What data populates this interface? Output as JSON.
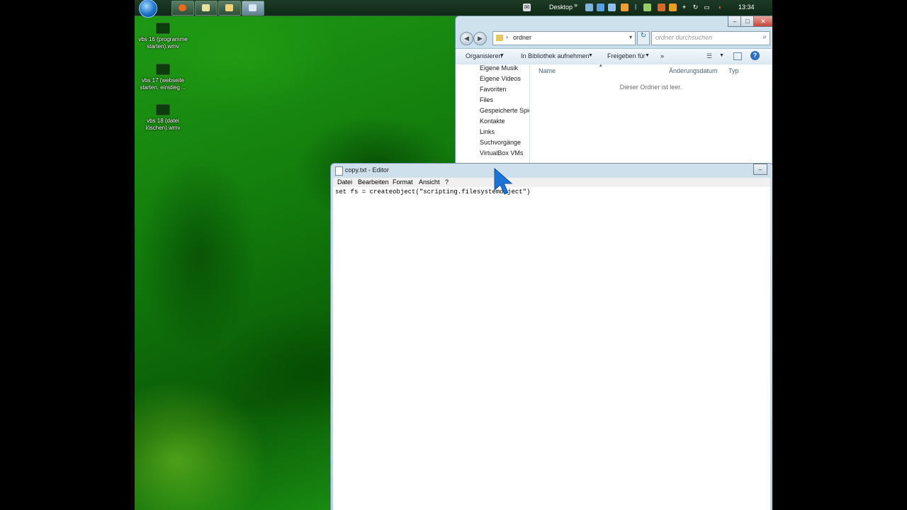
{
  "taskbar": {
    "desktop_label": "Desktop",
    "clock": "13:34",
    "tray_icons": [
      "network-icon",
      "chrome-icon",
      "network-icon",
      "folder-icon",
      "bluetooth-icon",
      "usb-icon",
      "arrow-icon",
      "flag-icon",
      "display-icon",
      "volume-muted-icon"
    ]
  },
  "desktop_icons": [
    {
      "label": "vbs 16 (programme starten).wmv"
    },
    {
      "label": "vbs 17 (webseite starten, einstieg ..."
    },
    {
      "label": "vbs 18 (datei löschen).wmv"
    }
  ],
  "explorer": {
    "address": "ordner",
    "search_placeholder": "ordner durchsuchen",
    "commands": {
      "organize": "Organisieren",
      "library": "In Bibliothek aufnehmen",
      "share": "Freigeben für",
      "more": "»"
    },
    "nav_items": [
      "Eigene Musik",
      "Eigene Videos",
      "Favoriten",
      "Files",
      "Gespeicherte Spiele",
      "Kontakte",
      "Links",
      "Suchvorgänge",
      "VirtualBox VMs"
    ],
    "columns": {
      "name": "Name",
      "date": "Änderungsdatum",
      "type": "Typ"
    },
    "empty_message": "Dieser Ordner ist leer."
  },
  "notepad": {
    "title": "copy.txt - Editor",
    "menu": [
      "Datei",
      "Bearbeiten",
      "Format",
      "Ansicht",
      "?"
    ],
    "content": "set fs = createobject(\"scripting.filesystemobject\")"
  },
  "colors": {
    "cursor": "#1b74d8",
    "desktop": "#127b0c"
  }
}
